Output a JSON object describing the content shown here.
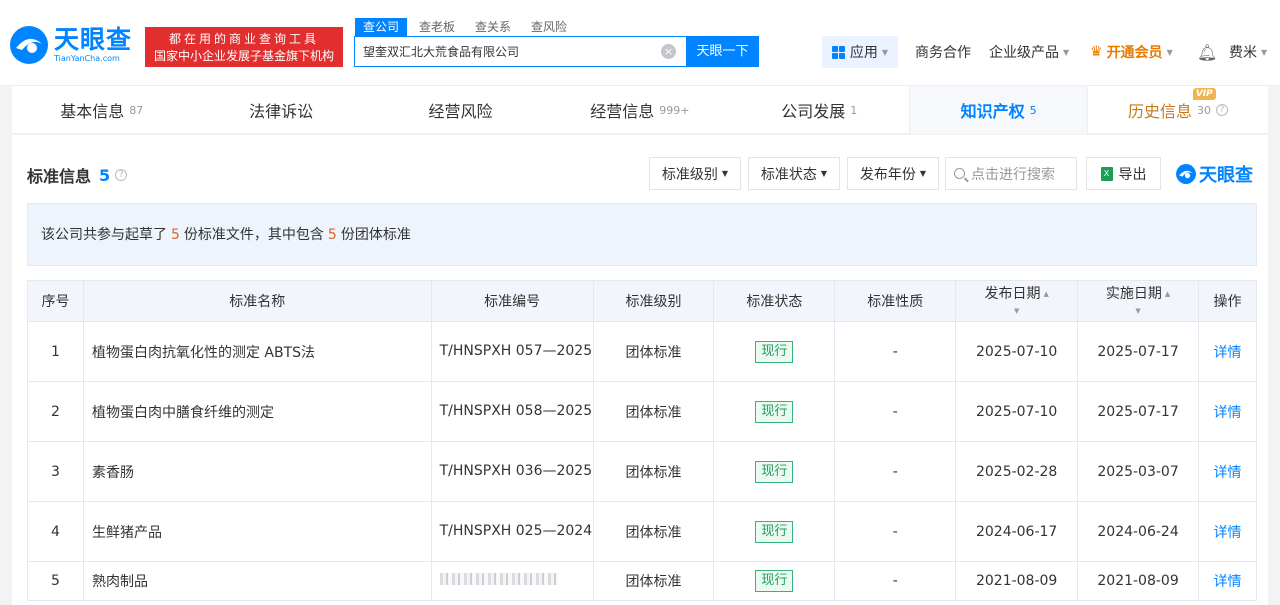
{
  "header": {
    "logo_cn": "天眼查",
    "logo_en": "TianYanCha.com",
    "promo_line1": "都在用的商业查询工具",
    "promo_line2": "国家中小企业发展子基金旗下机构",
    "search_tabs": [
      "查公司",
      "查老板",
      "查关系",
      "查风险"
    ],
    "search_value": "望奎双汇北大荒食品有限公司",
    "search_button": "天眼一下",
    "nav": {
      "apps": "应用",
      "business": "商务合作",
      "enterprise": "企业级产品",
      "vip": "开通会员",
      "user": "费米"
    }
  },
  "tabs": [
    {
      "label": "基本信息",
      "count": "87"
    },
    {
      "label": "法律诉讼",
      "count": ""
    },
    {
      "label": "经营风险",
      "count": ""
    },
    {
      "label": "经营信息",
      "count": "999+"
    },
    {
      "label": "公司发展",
      "count": "1"
    },
    {
      "label": "知识产权",
      "count": "5"
    },
    {
      "label": "历史信息",
      "count": "30",
      "badge": "VIP"
    }
  ],
  "section": {
    "title": "标准信息",
    "count": "5",
    "filters": [
      "标准级别",
      "标准状态",
      "发布年份"
    ],
    "search_placeholder": "点击进行搜索",
    "export": "导出",
    "watermark": "天眼查"
  },
  "summary": {
    "prefix": "该公司共参与起草了",
    "total": "5",
    "middle": "份标准文件，其中包含",
    "group": "5",
    "suffix": "份团体标准"
  },
  "table": {
    "headers": [
      "序号",
      "标准名称",
      "标准编号",
      "标准级别",
      "标准状态",
      "标准性质",
      "发布日期",
      "实施日期",
      "操作"
    ],
    "rows": [
      {
        "no": "1",
        "name": "植物蛋白肉抗氧化性的测定 ABTS法",
        "code": "T/HNSPXH 057—2025",
        "level": "团体标准",
        "status": "现行",
        "nature": "-",
        "publish": "2025-07-10",
        "effective": "2025-07-17",
        "action": "详情"
      },
      {
        "no": "2",
        "name": "植物蛋白肉中膳食纤维的测定",
        "code": "T/HNSPXH 058—2025",
        "level": "团体标准",
        "status": "现行",
        "nature": "-",
        "publish": "2025-07-10",
        "effective": "2025-07-17",
        "action": "详情"
      },
      {
        "no": "3",
        "name": "素香肠",
        "code": "T/HNSPXH 036—2025",
        "level": "团体标准",
        "status": "现行",
        "nature": "-",
        "publish": "2025-02-28",
        "effective": "2025-03-07",
        "action": "详情"
      },
      {
        "no": "4",
        "name": "生鲜猪产品",
        "code": "T/HNSPXH 025—2024",
        "level": "团体标准",
        "status": "现行",
        "nature": "-",
        "publish": "2024-06-17",
        "effective": "2024-06-24",
        "action": "详情"
      },
      {
        "no": "5",
        "name": "熟肉制品",
        "code": "",
        "level": "团体标准",
        "status": "现行",
        "nature": "-",
        "publish": "2021-08-09",
        "effective": "2021-08-09",
        "action": "详情"
      }
    ]
  }
}
